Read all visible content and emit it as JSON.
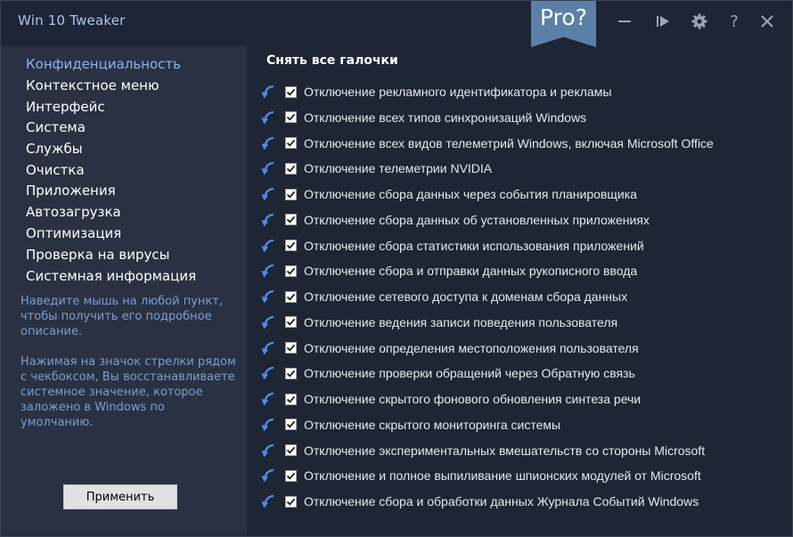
{
  "window": {
    "title": "Win 10 Tweaker"
  },
  "titlebar": {
    "pro_label": "Pro?"
  },
  "sidebar": {
    "items": [
      {
        "label": "Конфиденциальность",
        "active": true
      },
      {
        "label": "Контекстное меню"
      },
      {
        "label": "Интерфейс"
      },
      {
        "label": "Система"
      },
      {
        "label": "Службы"
      },
      {
        "label": "Очистка"
      },
      {
        "label": "Приложения"
      },
      {
        "label": "Автозагрузка"
      },
      {
        "label": "Оптимизация"
      },
      {
        "label": "Проверка на вирусы"
      },
      {
        "label": "Системная информация"
      }
    ],
    "hint1": "Наведите мышь на любой пункт, чтобы получить его подробное описание.",
    "hint2": "Нажимая на значок стрелки рядом с чекбоксом, Вы восстанавливаете системное значение, которое заложено в Windows по умолчанию.",
    "apply_label": "Применить"
  },
  "main": {
    "title": "Снять все галочки",
    "options": [
      {
        "label": "Отключение рекламного идентификатора и рекламы",
        "checked": true
      },
      {
        "label": "Отключение всех типов синхронизаций Windows",
        "checked": true
      },
      {
        "label": "Отключение всех видов телеметрий Windows, включая Microsoft Office",
        "checked": true
      },
      {
        "label": "Отключение телеметрии NVIDIA",
        "checked": true
      },
      {
        "label": "Отключение сбора данных через события планировщика",
        "checked": true
      },
      {
        "label": "Отключение сбора данных об установленных приложениях",
        "checked": true
      },
      {
        "label": "Отключение сбора статистики использования приложений",
        "checked": true
      },
      {
        "label": "Отключение сбора и отправки данных рукописного ввода",
        "checked": true
      },
      {
        "label": "Отключение сетевого доступа к доменам сбора данных",
        "checked": true
      },
      {
        "label": "Отключение ведения записи поведения пользователя",
        "checked": true
      },
      {
        "label": "Отключение определения местоположения пользователя",
        "checked": true
      },
      {
        "label": "Отключение проверки обращений через Обратную связь",
        "checked": true
      },
      {
        "label": "Отключение скрытого фонового обновления синтеза речи",
        "checked": true
      },
      {
        "label": "Отключение скрытого мониторинга системы",
        "checked": true
      },
      {
        "label": "Отключение экспериментальных вмешательств со стороны Microsoft",
        "checked": true
      },
      {
        "label": "Отключение и полное выпиливание шпионских модулей от Microsoft",
        "checked": true
      },
      {
        "label": "Отключение сбора и обработки данных Журнала Событий Windows",
        "checked": true
      }
    ]
  },
  "colors": {
    "background": "#1e2534",
    "sidebar": "#2a3142",
    "accent": "#8fb2ee",
    "hint": "#7a9fd6",
    "ribbon": "#5b80a8",
    "restore_arrow": "#4f8fe6"
  }
}
